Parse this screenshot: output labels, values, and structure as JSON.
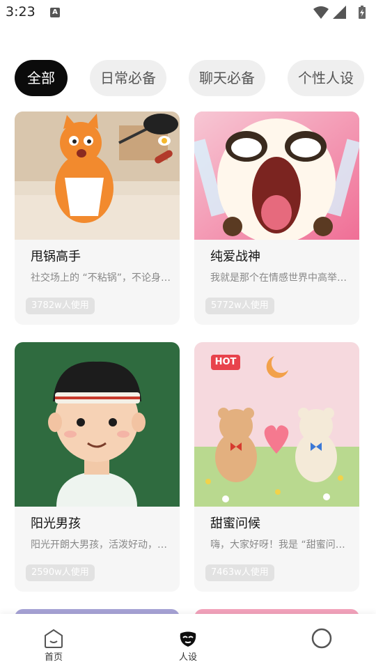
{
  "status_bar": {
    "time": "3:23",
    "notification_letter": "A"
  },
  "tabs": [
    {
      "label": "全部",
      "active": true
    },
    {
      "label": "日常必备",
      "active": false
    },
    {
      "label": "聊天必备",
      "active": false
    },
    {
      "label": "个性人设",
      "active": false
    }
  ],
  "cards": [
    {
      "title": "甩锅高手",
      "desc": "社交场上的 “不粘锅”，不论身…",
      "usage": "3782w人使用",
      "image": "orange-cat-with-frying-pan"
    },
    {
      "title": "纯爱战神",
      "desc": "我就是那个在情感世界中高举…",
      "usage": "5772w人使用",
      "image": "crying-cartoon-character"
    },
    {
      "title": "阳光男孩",
      "desc": "阳光开朗大男孩，活泼好动，…",
      "usage": "2590w人使用",
      "image": "boy-with-headband-avatar"
    },
    {
      "title": "甜蜜问候",
      "desc": "嗨，大家好呀！我是 “甜蜜问候…",
      "usage": "7463w人使用",
      "image": "two-bears-with-heart",
      "badge": "HOT"
    }
  ],
  "bottom_nav": [
    {
      "label": "首页",
      "icon": "home-face-icon",
      "active": false
    },
    {
      "label": "人设",
      "icon": "persona-mask-icon",
      "active": true
    },
    {
      "label": "",
      "icon": "profile-circle-icon",
      "active": false
    }
  ],
  "colors": {
    "active_tab": "#0b0b0b",
    "tab_bg": "#efefef",
    "card_bg": "#f6f6f6",
    "hot_badge": "#e8434c"
  }
}
